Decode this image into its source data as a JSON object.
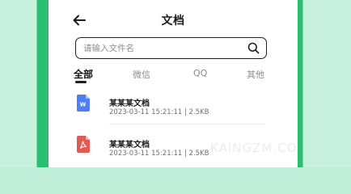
{
  "header": {
    "title": "文档",
    "back_icon": "arrow-left-icon"
  },
  "search": {
    "placeholder": "请输入文件名",
    "value": "",
    "icon": "search-icon"
  },
  "tabs": [
    {
      "label": "全部",
      "active": true
    },
    {
      "label": "微信",
      "active": false
    },
    {
      "label": "QQ",
      "active": false
    },
    {
      "label": "其他",
      "active": false
    }
  ],
  "files": [
    {
      "name": "某某某文档",
      "meta": "2023-03-11 15:21:11 | 2.5KB",
      "icon": "word-doc-icon",
      "icon_color": "#4f7ff2",
      "icon_letter": "W"
    },
    {
      "name": "某某某文档",
      "meta": "2023-03-11 15:21:11 | 2.5KB",
      "icon": "pdf-doc-icon",
      "icon_color": "#e05a52"
    }
  ],
  "watermark": "KAINGZM.COM",
  "colors": {
    "frame_outer": "#c7f1de",
    "frame_accent": "#2bbf73",
    "background": "#ffffff",
    "text_primary": "#1b1b1b",
    "text_secondary": "#8c8c8c"
  }
}
